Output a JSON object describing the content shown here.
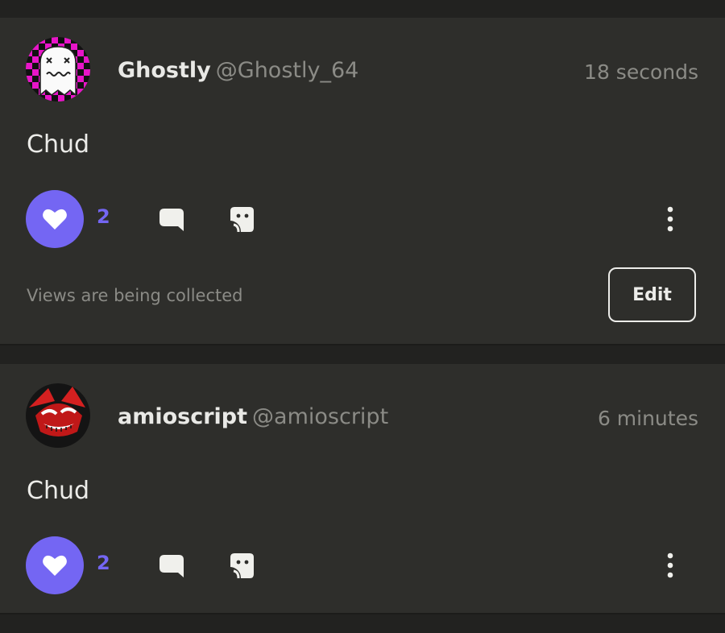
{
  "posts": [
    {
      "author": {
        "display_name": "Ghostly",
        "handle": "@Ghostly_64",
        "avatar_icon": "ghost-avatar-icon"
      },
      "time": "18 seconds",
      "content": "Chud",
      "likes": "2",
      "views_note": "Views are being collected",
      "edit_label": "Edit"
    },
    {
      "author": {
        "display_name": "amioscript",
        "handle": "@amioscript",
        "avatar_icon": "character-avatar-icon"
      },
      "time": "6 minutes",
      "content": "Chud",
      "likes": "2"
    }
  ],
  "colors": {
    "accent": "#7466f3",
    "card": "#2e2e2b",
    "background": "#222220"
  }
}
